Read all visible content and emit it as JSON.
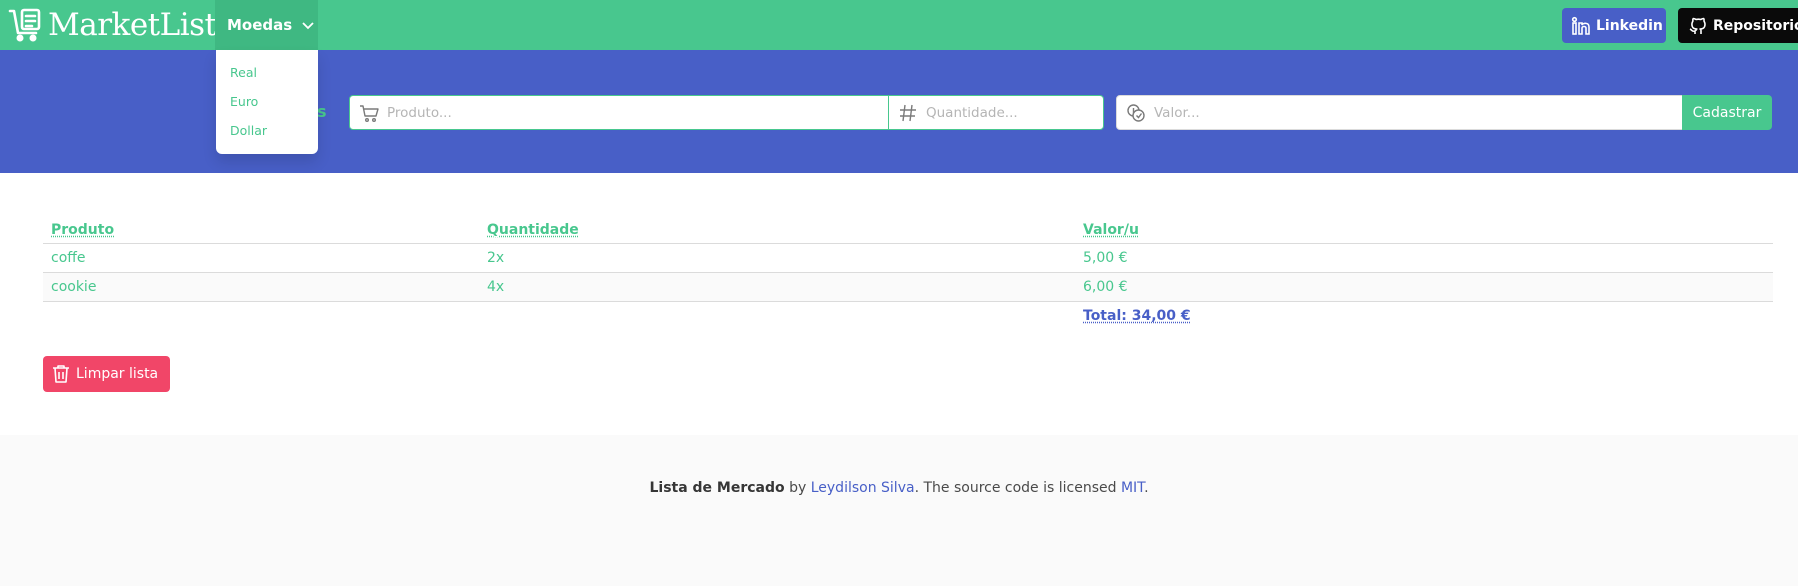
{
  "brand": {
    "name": "MarketList",
    "icon": "cart-list-icon"
  },
  "nav": {
    "moedas_label": "Moedas",
    "linkedin_label": "Linkedin",
    "repo_label": "Repositorio"
  },
  "dropdown": {
    "items": [
      "Real",
      "Euro",
      "Dollar"
    ]
  },
  "form": {
    "label_visible": "s",
    "produto_placeholder": "Produto...",
    "quantidade_placeholder": "Quantidade...",
    "valor_placeholder": "Valor...",
    "submit_label": "Cadastrar"
  },
  "table": {
    "headers": [
      "Produto",
      "Quantidade",
      "Valor/u"
    ],
    "rows": [
      {
        "produto": "coffe",
        "quantidade": "2x",
        "valor": "5,00 €"
      },
      {
        "produto": "cookie",
        "quantidade": "4x",
        "valor": "6,00 €"
      }
    ],
    "total": "Total: 34,00 €"
  },
  "actions": {
    "clear_label": "Limpar lista"
  },
  "footer": {
    "title": "Lista de Mercado",
    "by": " by ",
    "author": "Leydilson Silva",
    "middle": ". The source code is licensed ",
    "license": "MIT",
    "end": "."
  },
  "colors": {
    "primary": "#48c78e",
    "link": "#485fc7",
    "danger": "#f14668",
    "dark": "#0a0a0a"
  }
}
